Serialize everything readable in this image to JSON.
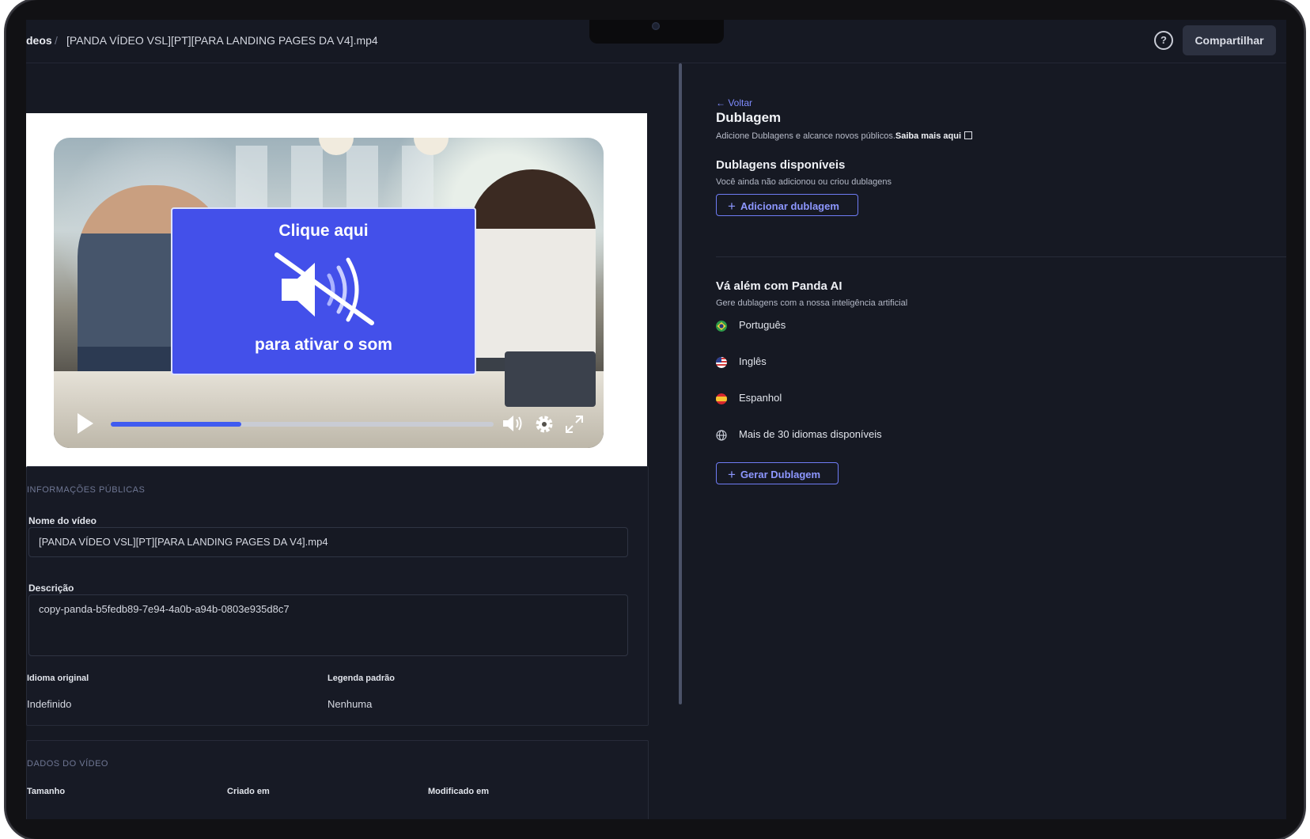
{
  "breadcrumb": {
    "root": "deos",
    "separator": "/",
    "current": "[PANDA VÍDEO VSL][PT][PARA LANDING PAGES DA V4].mp4"
  },
  "header": {
    "help_icon": "question-circle-icon",
    "share_label": "Compartilhar"
  },
  "player": {
    "overlay_top": "Clique aqui",
    "overlay_bottom": "para ativar o som",
    "overlay_icon": "muted-speaker-icon",
    "progress_fraction": 0.34
  },
  "public_info": {
    "section_title": "INFORMAÇÕES PÚBLICAS",
    "name_label": "Nome do vídeo",
    "name_value": "[PANDA VÍDEO VSL][PT][PARA LANDING PAGES DA V4].mp4",
    "description_label": "Descrição",
    "description_value": "copy-panda-b5fedb89-7e94-4a0b-a94b-0803e935d8c7",
    "original_language_label": "Idioma original",
    "original_language_value": "Indefinido",
    "default_subtitle_label": "Legenda padrão",
    "default_subtitle_value": "Nenhuma"
  },
  "video_data": {
    "section_title": "DADOS DO VÍDEO",
    "size_label": "Tamanho",
    "created_label": "Criado em",
    "modified_label": "Modificado em"
  },
  "dubbing": {
    "back_label": "← Voltar",
    "title": "Dublagem",
    "subtitle": "Adicione Dublagens e alcance novos públicos.",
    "learn_more": "Saiba mais aqui",
    "available_title": "Dublagens disponíveis",
    "available_sub": "Você ainda não adicionou ou criou dublagens",
    "add_button": "Adicionar dublagem",
    "ai_title": "Vá além com Panda AI",
    "ai_sub": "Gere dublagens com a nossa inteligência artificial",
    "languages": [
      {
        "label": "Português",
        "icon": "brazil-flag-icon"
      },
      {
        "label": "Inglês",
        "icon": "usa-flag-icon"
      },
      {
        "label": "Espanhol",
        "icon": "spain-flag-icon"
      },
      {
        "label": "Mais de 30 idiomas disponíveis",
        "icon": "globe-icon"
      }
    ],
    "generate_button": "Gerar Dublagem"
  },
  "colors": {
    "background": "#161923",
    "accent": "#7f8cff",
    "overlay_blue": "#4350ea"
  }
}
